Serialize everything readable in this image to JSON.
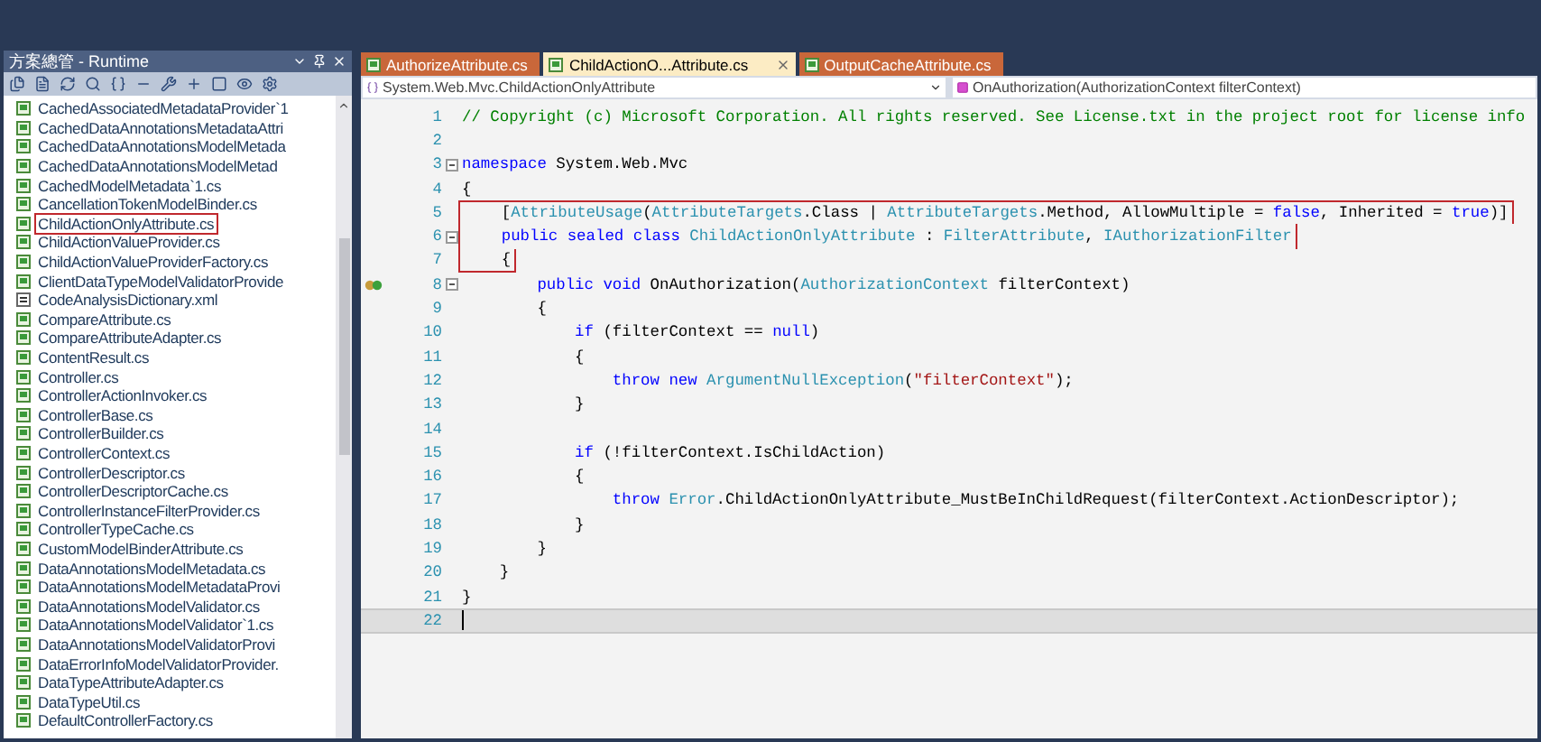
{
  "solution_explorer": {
    "title": "方案總管 - Runtime",
    "items": [
      {
        "label": "CachedAssociatedMetadataProvider`1",
        "kind": "cs",
        "selected": false
      },
      {
        "label": "CachedDataAnnotationsMetadataAttri",
        "kind": "cs",
        "selected": false
      },
      {
        "label": "CachedDataAnnotationsModelMetada",
        "kind": "cs",
        "selected": false
      },
      {
        "label": "CachedDataAnnotationsModelMetad",
        "kind": "cs",
        "selected": false
      },
      {
        "label": "CachedModelMetadata`1.cs",
        "kind": "cs",
        "selected": false
      },
      {
        "label": "CancellationTokenModelBinder.cs",
        "kind": "cs",
        "selected": false
      },
      {
        "label": "ChildActionOnlyAttribute.cs",
        "kind": "cs",
        "selected": true
      },
      {
        "label": "ChildActionValueProvider.cs",
        "kind": "cs",
        "selected": false
      },
      {
        "label": "ChildActionValueProviderFactory.cs",
        "kind": "cs",
        "selected": false
      },
      {
        "label": "ClientDataTypeModelValidatorProvide",
        "kind": "cs",
        "selected": false
      },
      {
        "label": "CodeAnalysisDictionary.xml",
        "kind": "xml",
        "selected": false
      },
      {
        "label": "CompareAttribute.cs",
        "kind": "cs",
        "selected": false
      },
      {
        "label": "CompareAttributeAdapter.cs",
        "kind": "cs",
        "selected": false
      },
      {
        "label": "ContentResult.cs",
        "kind": "cs",
        "selected": false
      },
      {
        "label": "Controller.cs",
        "kind": "cs",
        "selected": false
      },
      {
        "label": "ControllerActionInvoker.cs",
        "kind": "cs",
        "selected": false
      },
      {
        "label": "ControllerBase.cs",
        "kind": "cs",
        "selected": false
      },
      {
        "label": "ControllerBuilder.cs",
        "kind": "cs",
        "selected": false
      },
      {
        "label": "ControllerContext.cs",
        "kind": "cs",
        "selected": false
      },
      {
        "label": "ControllerDescriptor.cs",
        "kind": "cs",
        "selected": false
      },
      {
        "label": "ControllerDescriptorCache.cs",
        "kind": "cs",
        "selected": false
      },
      {
        "label": "ControllerInstanceFilterProvider.cs",
        "kind": "cs",
        "selected": false
      },
      {
        "label": "ControllerTypeCache.cs",
        "kind": "cs",
        "selected": false
      },
      {
        "label": "CustomModelBinderAttribute.cs",
        "kind": "cs",
        "selected": false
      },
      {
        "label": "DataAnnotationsModelMetadata.cs",
        "kind": "cs",
        "selected": false
      },
      {
        "label": "DataAnnotationsModelMetadataProvi",
        "kind": "cs",
        "selected": false
      },
      {
        "label": "DataAnnotationsModelValidator.cs",
        "kind": "cs",
        "selected": false
      },
      {
        "label": "DataAnnotationsModelValidator`1.cs",
        "kind": "cs",
        "selected": false
      },
      {
        "label": "DataAnnotationsModelValidatorProvi",
        "kind": "cs",
        "selected": false
      },
      {
        "label": "DataErrorInfoModelValidatorProvider.",
        "kind": "cs",
        "selected": false
      },
      {
        "label": "DataTypeAttributeAdapter.cs",
        "kind": "cs",
        "selected": false
      },
      {
        "label": "DataTypeUtil.cs",
        "kind": "cs",
        "selected": false
      },
      {
        "label": "DefaultControllerFactory.cs",
        "kind": "cs",
        "selected": false
      }
    ]
  },
  "tabs": [
    {
      "label": "AuthorizeAttribute.cs",
      "selected": false
    },
    {
      "label": "ChildActionO...Attribute.cs",
      "selected": true
    },
    {
      "label": "OutputCacheAttribute.cs",
      "selected": false
    }
  ],
  "navigation": {
    "type_dropdown": "System.Web.Mvc.ChildActionOnlyAttribute",
    "member_dropdown": "OnAuthorization(AuthorizationContext filterContext)"
  },
  "code_lines": [
    {
      "number": "1",
      "collapsible": false,
      "highlighted": false,
      "current": false,
      "breakpoint": false,
      "tokens": [
        {
          "kind": "comment",
          "text": "// Copyright (c) Microsoft Corporation. All rights reserved. See License.txt in the project root for license info"
        }
      ]
    },
    {
      "number": "2",
      "collapsible": false,
      "highlighted": false,
      "current": false,
      "breakpoint": false
    },
    {
      "number": "3",
      "collapsible": true,
      "highlighted": false,
      "current": false,
      "breakpoint": false,
      "tokens": [
        {
          "kind": "keyword",
          "text": "namespace"
        },
        {
          "kind": "plain",
          "text": " System.Web.Mvc"
        }
      ]
    },
    {
      "number": "4",
      "collapsible": false,
      "highlighted": false,
      "current": false,
      "breakpoint": false,
      "tokens": [
        {
          "kind": "plain",
          "text": "{"
        }
      ]
    },
    {
      "number": "5",
      "collapsible": false,
      "highlighted": true,
      "current": false,
      "breakpoint": false,
      "tokens": [
        {
          "kind": "plain",
          "text": "    ["
        },
        {
          "kind": "type",
          "text": "AttributeUsage"
        },
        {
          "kind": "plain",
          "text": "("
        },
        {
          "kind": "type",
          "text": "AttributeTargets"
        },
        {
          "kind": "plain",
          "text": ".Class | "
        },
        {
          "kind": "type",
          "text": "AttributeTargets"
        },
        {
          "kind": "plain",
          "text": ".Method, AllowMultiple = "
        },
        {
          "kind": "keyword",
          "text": "false"
        },
        {
          "kind": "plain",
          "text": ", Inherited = "
        },
        {
          "kind": "keyword",
          "text": "true"
        },
        {
          "kind": "plain",
          "text": ")]"
        }
      ]
    },
    {
      "number": "6",
      "collapsible": true,
      "highlighted": true,
      "current": false,
      "breakpoint": false,
      "tokens": [
        {
          "kind": "keyword",
          "text": "    public sealed class"
        },
        {
          "kind": "type",
          "text": " ChildActionOnlyAttribute"
        },
        {
          "kind": "plain",
          "text": " : "
        },
        {
          "kind": "type",
          "text": "FilterAttribute"
        },
        {
          "kind": "plain",
          "text": ", "
        },
        {
          "kind": "type",
          "text": "IAuthorizationFilter"
        }
      ]
    },
    {
      "number": "7",
      "collapsible": false,
      "highlighted": true,
      "current": false,
      "breakpoint": false,
      "tokens": [
        {
          "kind": "plain",
          "text": "    {"
        }
      ]
    },
    {
      "number": "8",
      "collapsible": true,
      "highlighted": false,
      "current": false,
      "breakpoint": true,
      "tokens": [
        {
          "kind": "keyword",
          "text": "        public void"
        },
        {
          "kind": "plain",
          "text": " OnAuthorization("
        },
        {
          "kind": "type",
          "text": "AuthorizationContext"
        },
        {
          "kind": "plain",
          "text": " filterContext)"
        }
      ]
    },
    {
      "number": "9",
      "collapsible": false,
      "highlighted": false,
      "current": false,
      "breakpoint": false,
      "tokens": [
        {
          "kind": "plain",
          "text": "        {"
        }
      ]
    },
    {
      "number": "10",
      "collapsible": false,
      "highlighted": false,
      "current": false,
      "breakpoint": false,
      "tokens": [
        {
          "kind": "keyword",
          "text": "            if"
        },
        {
          "kind": "plain",
          "text": " (filterContext == "
        },
        {
          "kind": "keyword",
          "text": "null"
        },
        {
          "kind": "plain",
          "text": ")"
        }
      ]
    },
    {
      "number": "11",
      "collapsible": false,
      "highlighted": false,
      "current": false,
      "breakpoint": false,
      "tokens": [
        {
          "kind": "plain",
          "text": "            {"
        }
      ]
    },
    {
      "number": "12",
      "collapsible": false,
      "highlighted": false,
      "current": false,
      "breakpoint": false,
      "tokens": [
        {
          "kind": "keyword",
          "text": "                throw new"
        },
        {
          "kind": "type",
          "text": " ArgumentNullException"
        },
        {
          "kind": "plain",
          "text": "("
        },
        {
          "kind": "string",
          "text": "\"filterContext\""
        },
        {
          "kind": "plain",
          "text": ");"
        }
      ]
    },
    {
      "number": "13",
      "collapsible": false,
      "highlighted": false,
      "current": false,
      "breakpoint": false,
      "tokens": [
        {
          "kind": "plain",
          "text": "            }"
        }
      ]
    },
    {
      "number": "14",
      "collapsible": false,
      "highlighted": false,
      "current": false,
      "breakpoint": false
    },
    {
      "number": "15",
      "collapsible": false,
      "highlighted": false,
      "current": false,
      "breakpoint": false,
      "tokens": [
        {
          "kind": "keyword",
          "text": "            if"
        },
        {
          "kind": "plain",
          "text": " (!filterContext.IsChildAction)"
        }
      ]
    },
    {
      "number": "16",
      "collapsible": false,
      "highlighted": false,
      "current": false,
      "breakpoint": false,
      "tokens": [
        {
          "kind": "plain",
          "text": "            {"
        }
      ]
    },
    {
      "number": "17",
      "collapsible": false,
      "highlighted": false,
      "current": false,
      "breakpoint": false,
      "tokens": [
        {
          "kind": "keyword",
          "text": "                throw"
        },
        {
          "kind": "type",
          "text": " Error"
        },
        {
          "kind": "plain",
          "text": ".ChildActionOnlyAttribute_MustBeInChildRequest(filterContext.ActionDescriptor);"
        }
      ]
    },
    {
      "number": "18",
      "collapsible": false,
      "highlighted": false,
      "current": false,
      "breakpoint": false,
      "tokens": [
        {
          "kind": "plain",
          "text": "            }"
        }
      ]
    },
    {
      "number": "19",
      "collapsible": false,
      "highlighted": false,
      "current": false,
      "breakpoint": false,
      "tokens": [
        {
          "kind": "plain",
          "text": "        }"
        }
      ]
    },
    {
      "number": "20",
      "collapsible": false,
      "highlighted": false,
      "current": false,
      "breakpoint": false,
      "tokens": [
        {
          "kind": "plain",
          "text": "    }"
        }
      ]
    },
    {
      "number": "21",
      "collapsible": false,
      "highlighted": false,
      "current": false,
      "breakpoint": false,
      "tokens": [
        {
          "kind": "plain",
          "text": "}"
        }
      ]
    },
    {
      "number": "22",
      "collapsible": false,
      "highlighted": false,
      "current": true,
      "breakpoint": false
    }
  ]
}
